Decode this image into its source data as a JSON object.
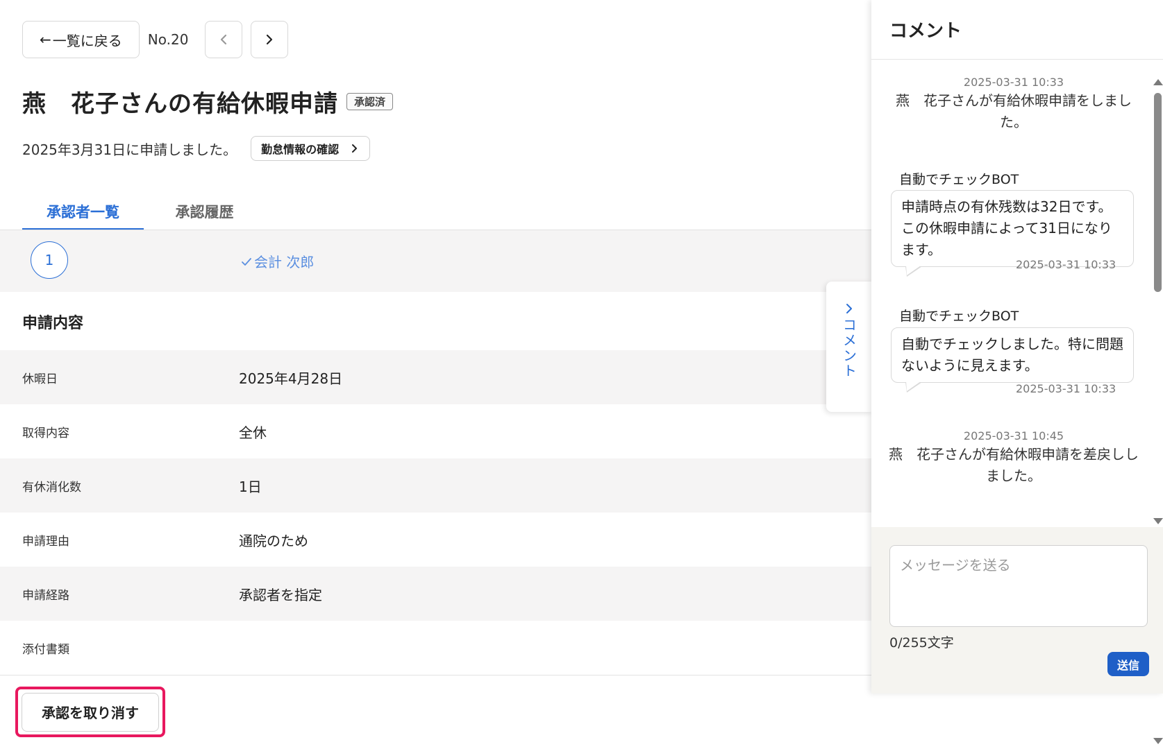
{
  "nav": {
    "back_label": "一覧に戻る",
    "back_arrow": "←",
    "record_no": "No.20",
    "prev_icon": "chevron-left-icon",
    "next_icon": "chevron-right-icon"
  },
  "header": {
    "title": "燕　花子さんの有給休暇申請",
    "status": "承認済",
    "applied_text": "2025年3月31日に申請しました。",
    "attendance_button": "勤怠情報の確認"
  },
  "tabs": [
    {
      "label": "承認者一覧",
      "active": true
    },
    {
      "label": "承認履歴",
      "active": false
    }
  ],
  "approvers": [
    {
      "step": "1",
      "name": "会計 次郎",
      "approved": true
    }
  ],
  "details": {
    "section_title": "申請内容",
    "rows": [
      {
        "label": "休暇日",
        "value": "2025年4月28日"
      },
      {
        "label": "取得内容",
        "value": "全休"
      },
      {
        "label": "有休消化数",
        "value": "1日"
      },
      {
        "label": "申請理由",
        "value": "通院のため"
      },
      {
        "label": "申請経路",
        "value": "承認者を指定"
      },
      {
        "label": "添付書類",
        "value": ""
      }
    ]
  },
  "actions": {
    "cancel_approval": "承認を取り消す"
  },
  "comment_toggle": {
    "label": "コメント"
  },
  "comments": {
    "title": "コメント",
    "items": [
      {
        "type": "system",
        "timestamp": "2025-03-31 10:33",
        "text": "燕　花子さんが有給休暇申請をしました。"
      },
      {
        "type": "bot",
        "author": "自動でチェックBOT",
        "text": "申請時点の有休残数は32日です。この休暇申請によって31日になります。",
        "timestamp": "2025-03-31 10:33"
      },
      {
        "type": "bot",
        "author": "自動でチェックBOT",
        "text": "自動でチェックしました。特に問題ないように見えます。",
        "timestamp": "2025-03-31 10:33"
      },
      {
        "type": "system",
        "timestamp": "2025-03-31 10:45",
        "text": "燕　花子さんが有給休暇申請を差戻ししました。"
      }
    ],
    "input_placeholder": "メッセージを送る",
    "char_count": "0/255文字",
    "send_label": "送信"
  },
  "colors": {
    "accent": "#2b6fd6",
    "highlight_border": "#e8185e",
    "send_button": "#1f5fc7",
    "row_alt": "#f5f4f4"
  }
}
